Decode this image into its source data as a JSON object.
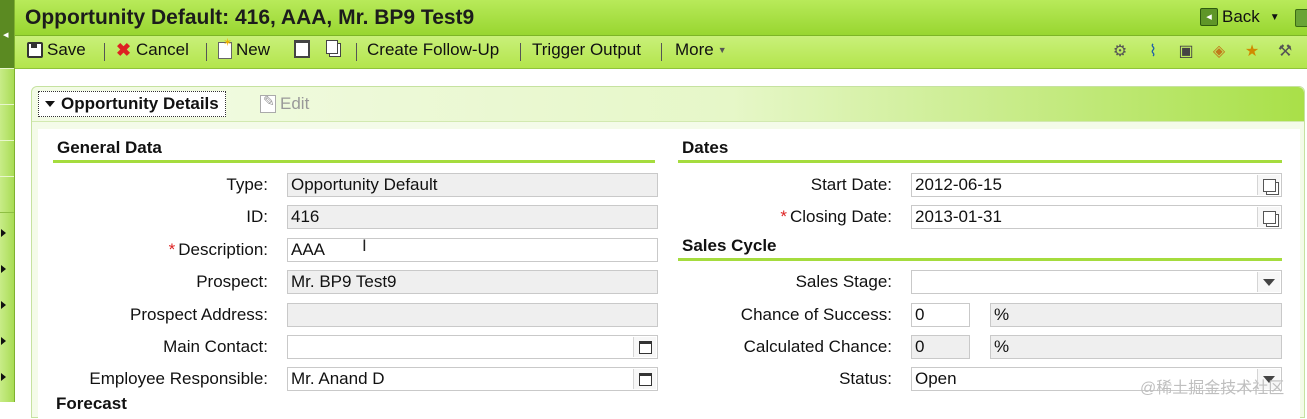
{
  "title": "Opportunity Default: 416, AAA, Mr. BP9 Test9",
  "nav": {
    "back_label": "Back"
  },
  "toolbar": {
    "save": "Save",
    "cancel": "Cancel",
    "new": "New",
    "create_follow_up": "Create Follow-Up",
    "trigger_output": "Trigger Output",
    "more": "More",
    "right_icons": [
      "gear-icon",
      "rss-icon",
      "document-settings-icon",
      "tag-icon",
      "favorite-icon",
      "wrench-icon"
    ]
  },
  "panel": {
    "title": "Opportunity Details",
    "edit_label": "Edit"
  },
  "general": {
    "section_title": "General Data",
    "type_label": "Type:",
    "type_value": "Opportunity Default",
    "id_label": "ID:",
    "id_value": "416",
    "description_label": "Description:",
    "description_value": "AAA",
    "prospect_label": "Prospect:",
    "prospect_value": "Mr. BP9 Test9",
    "prospect_address_label": "Prospect Address:",
    "prospect_address_value": "",
    "main_contact_label": "Main Contact:",
    "main_contact_value": "",
    "employee_label": "Employee Responsible:",
    "employee_value": "Mr. Anand D",
    "next_section_partial": "Forecast"
  },
  "dates": {
    "section_title": "Dates",
    "start_label": "Start Date:",
    "start_value": "2012-06-15",
    "closing_label": "Closing Date:",
    "closing_value": "2013-01-31"
  },
  "sales_cycle": {
    "section_title": "Sales Cycle",
    "stage_label": "Sales Stage:",
    "stage_value": "",
    "chance_label": "Chance of Success:",
    "chance_value": "0",
    "chance_unit": "%",
    "calc_label": "Calculated Chance:",
    "calc_value": "0",
    "calc_unit": "%",
    "status_label": "Status:",
    "status_value": "Open"
  },
  "watermark": "@稀土掘金技术社区",
  "colors": {
    "accent": "#a5dc3e",
    "title_bar": "#98d630",
    "required": "#dd2222"
  }
}
